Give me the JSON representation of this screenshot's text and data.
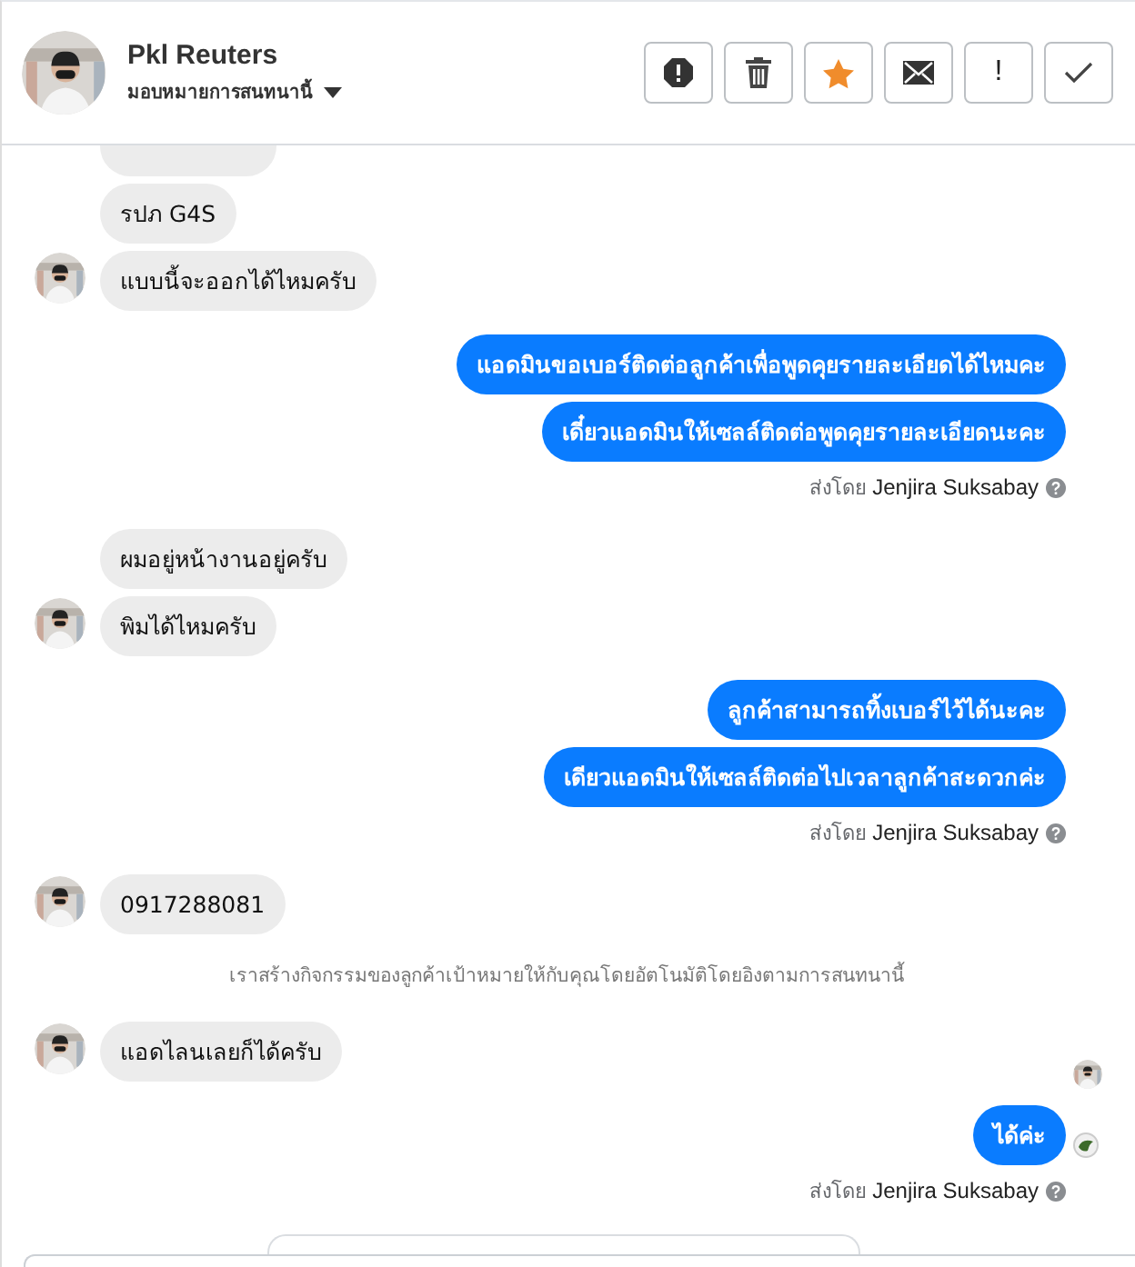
{
  "header": {
    "name": "Pkl Reuters",
    "assign": "มอบหมายการสนทนานี้",
    "actions": [
      {
        "kind": "spam"
      },
      {
        "kind": "trash"
      },
      {
        "kind": "star",
        "on": true
      },
      {
        "kind": "mail"
      },
      {
        "kind": "text",
        "label": "!"
      },
      {
        "kind": "check"
      }
    ]
  },
  "messages": [
    {
      "kind": "in",
      "avatar": false
    },
    {
      "kind": "in",
      "text": "รปภ G4S",
      "avatar": false
    },
    {
      "kind": "in",
      "text": "แบบนี้จะออกได้ไหมครับ",
      "avatar": true
    },
    {
      "kind": "out",
      "text": "แอดมินขอเบอร์ติดต่อลูกค้าเพื่อพูดคุยรายละเอียดได้ไหมคะ"
    },
    {
      "kind": "out",
      "text": "เดี๋ยวแอดมินให้เซลล์ติดต่อพูดคุยรายละเอียดนะคะ"
    },
    {
      "kind": "sent_by",
      "label": "ส่งโดย",
      "sender": "Jenjira Suksabay"
    },
    {
      "kind": "in",
      "text": "ผมอยู่หน้างานอยู่ครับ",
      "avatar": false
    },
    {
      "kind": "in",
      "text": "พิมได้ไหมครับ",
      "avatar": true
    },
    {
      "kind": "out",
      "text": "ลูกค้าสามารถทิ้งเบอร์ไว้ได้นะคะ"
    },
    {
      "kind": "out",
      "text": "เดียวแอดมินให้เซลล์ติดต่อไปเวลาลูกค้าสะดวกค่ะ"
    },
    {
      "kind": "sent_by",
      "label": "ส่งโดย",
      "sender": "Jenjira Suksabay"
    },
    {
      "kind": "in",
      "text": "0917288081",
      "avatar": true
    },
    {
      "kind": "system",
      "text": "เราสร้างกิจกรรมของลูกค้าเป้าหมายให้กับคุณโดยอัตโนมัติโดยอิงตามการสนทนานี้"
    },
    {
      "kind": "in",
      "text": "แอดไลนเลยก็ได้ครับ",
      "avatar": true,
      "seen": true
    },
    {
      "kind": "out",
      "text": "ได้ค่ะ",
      "seen": true
    },
    {
      "kind": "sent_by",
      "label": "ส่งโดย",
      "sender": "Jenjira Suksabay"
    }
  ]
}
